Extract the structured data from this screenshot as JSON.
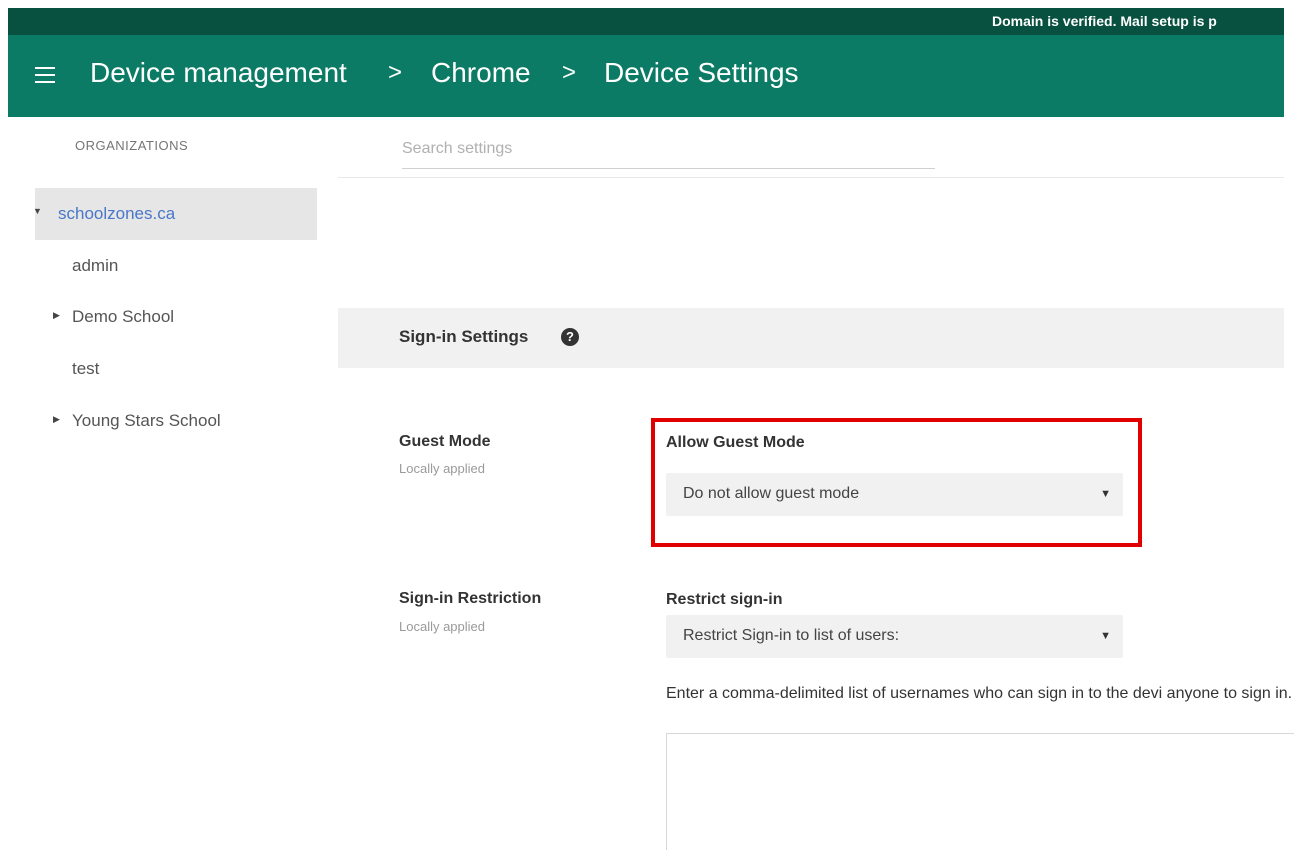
{
  "notification": {
    "text": "Domain is verified. Mail setup is p"
  },
  "header": {
    "breadcrumb": [
      "Device management",
      "Chrome",
      "Device Settings"
    ],
    "separator": ">"
  },
  "sidebar": {
    "heading": "ORGANIZATIONS",
    "items": [
      {
        "label": "schoolzones.ca",
        "selected": true,
        "expanded": true
      },
      {
        "label": "admin"
      },
      {
        "label": "Demo School",
        "expandable": true
      },
      {
        "label": "test"
      },
      {
        "label": "Young Stars School",
        "expandable": true
      }
    ]
  },
  "search": {
    "placeholder": "Search settings",
    "value": ""
  },
  "section": {
    "title": "Sign-in Settings",
    "help_glyph": "?"
  },
  "settings": {
    "guest_mode": {
      "name": "Guest Mode",
      "subtext": "Locally applied",
      "field_label": "Allow Guest Mode",
      "selected": "Do not allow guest mode"
    },
    "sign_in_restriction": {
      "name": "Sign-in Restriction",
      "subtext": "Locally applied",
      "field_label": "Restrict sign-in",
      "selected": "Restrict Sign-in to list of users:",
      "description": "Enter a comma-delimited list of usernames who can sign in to the devi anyone to sign in.",
      "textarea_value": ""
    }
  },
  "colors": {
    "header_bg": "#0c7b65",
    "notify_bg": "#08503f",
    "highlight": "#e00000",
    "selected_link": "#4a77c9"
  }
}
